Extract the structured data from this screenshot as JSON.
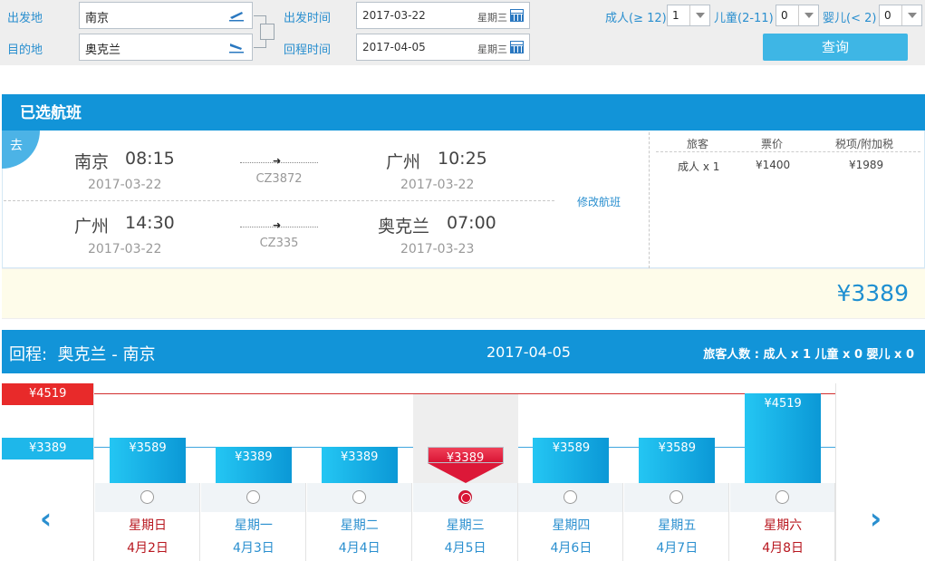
{
  "search": {
    "from_label": "出发地",
    "to_label": "目的地",
    "from_value": "南京",
    "to_value": "奥克兰",
    "depart_label": "出发时间",
    "return_label": "回程时间",
    "depart_date": "2017-03-22",
    "depart_weekday": "星期三",
    "return_date": "2017-04-05",
    "return_weekday": "星期三",
    "adult_label": "成人(≥ 12)",
    "adult_value": "1",
    "child_label": "儿童(2-11)",
    "child_value": "0",
    "infant_label": "婴儿(< 2)",
    "infant_value": "0",
    "button": "查询"
  },
  "selected": {
    "title": "已选航班",
    "badge": "去",
    "segments": [
      {
        "from_city": "南京",
        "from_time": "08:15",
        "from_date": "2017-03-22",
        "flight_no": "CZ3872",
        "to_city": "广州",
        "to_time": "10:25",
        "to_date": "2017-03-22"
      },
      {
        "from_city": "广州",
        "from_time": "14:30",
        "from_date": "2017-03-22",
        "flight_no": "CZ335",
        "to_city": "奥克兰",
        "to_time": "07:00",
        "to_date": "2017-03-23"
      }
    ],
    "modify": "修改航班",
    "price_headers": {
      "passenger": "旅客",
      "fare": "票价",
      "tax": "税项/附加税"
    },
    "price_row": {
      "passenger": "成人 x 1",
      "fare": "¥1400",
      "tax": "¥1989"
    },
    "total": "¥3389"
  },
  "return": {
    "label": "回程:",
    "route": "奥克兰 - 南京",
    "date": "2017-04-05",
    "passengers": "旅客人数 : 成人 x 1   儿童 x 0   婴儿 x 0",
    "max_label": "¥4519",
    "min_label": "¥3389",
    "days": [
      {
        "weekday": "星期日",
        "date": "4月2日",
        "price": "¥3589",
        "weekend": true
      },
      {
        "weekday": "星期一",
        "date": "4月3日",
        "price": "¥3389",
        "weekend": false
      },
      {
        "weekday": "星期二",
        "date": "4月4日",
        "price": "¥3389",
        "weekend": false
      },
      {
        "weekday": "星期三",
        "date": "4月5日",
        "price": "¥3389",
        "weekend": false,
        "selected": true
      },
      {
        "weekday": "星期四",
        "date": "4月6日",
        "price": "¥3589",
        "weekend": false
      },
      {
        "weekday": "星期五",
        "date": "4月7日",
        "price": "¥3589",
        "weekend": false
      },
      {
        "weekday": "星期六",
        "date": "4月8日",
        "price": "¥4519",
        "weekend": true
      }
    ],
    "prev_icon": "chevron-left-icon",
    "next_icon": "chevron-right-icon"
  },
  "chart_data": {
    "type": "bar",
    "categories": [
      "4月2日",
      "4月3日",
      "4月4日",
      "4月5日",
      "4月6日",
      "4月7日",
      "4月8日"
    ],
    "values": [
      3589,
      3389,
      3389,
      3389,
      3589,
      3589,
      4519
    ],
    "ylim": [
      3389,
      4519
    ]
  },
  "colors": {
    "accent": "#1294d8",
    "max": "#e82a2a",
    "min": "#1eb7ea",
    "selected": "#d91535"
  }
}
